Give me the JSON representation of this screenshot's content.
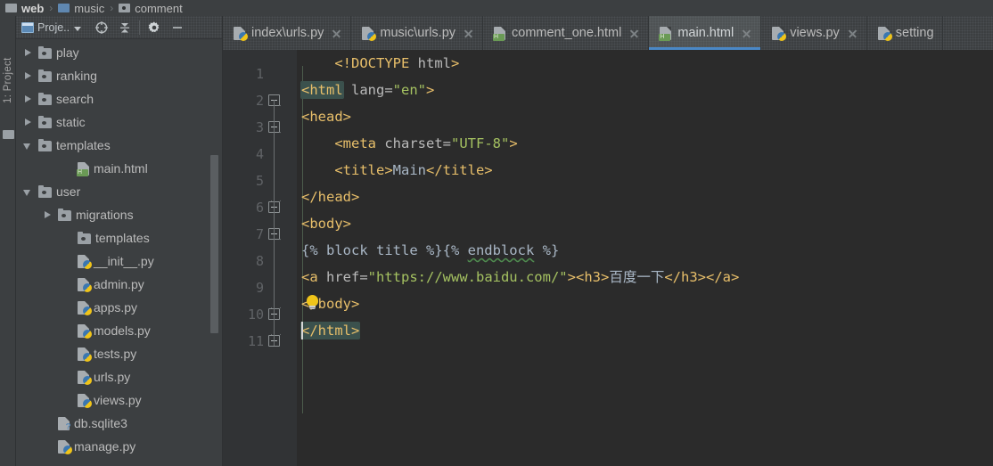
{
  "breadcrumb": {
    "items": [
      {
        "label": "web",
        "icon": "folder-icon"
      },
      {
        "label": "music",
        "icon": "folder-icon"
      },
      {
        "label": "comment",
        "icon": "folder-icon"
      }
    ],
    "separator": "›"
  },
  "toolwindow": {
    "vertical_tab_label": "1: Project"
  },
  "project_panel": {
    "title": "Proje..",
    "toolbar_buttons": [
      {
        "name": "select-opened-file-button",
        "icon": "target-icon"
      },
      {
        "name": "collapse-all-button",
        "icon": "collapse-all-icon"
      },
      {
        "name": "settings-button",
        "icon": "gear-icon"
      },
      {
        "name": "hide-button",
        "icon": "minimize-icon"
      }
    ],
    "tree": [
      {
        "label": "play",
        "icon": "folder-icon",
        "arrow": "right",
        "indent": 1
      },
      {
        "label": "ranking",
        "icon": "folder-icon",
        "arrow": "right",
        "indent": 1
      },
      {
        "label": "search",
        "icon": "folder-icon",
        "arrow": "right",
        "indent": 1
      },
      {
        "label": "static",
        "icon": "folder-icon",
        "arrow": "right",
        "indent": 1
      },
      {
        "label": "templates",
        "icon": "folder-icon",
        "arrow": "down",
        "indent": 1
      },
      {
        "label": "main.html",
        "icon": "html-file-icon",
        "arrow": "none",
        "indent": 3
      },
      {
        "label": "user",
        "icon": "folder-icon",
        "arrow": "down",
        "indent": 1
      },
      {
        "label": "migrations",
        "icon": "folder-icon",
        "arrow": "right",
        "indent": 2
      },
      {
        "label": "templates",
        "icon": "folder-icon",
        "arrow": "none",
        "indent": 3
      },
      {
        "label": "__init__.py",
        "icon": "python-file-icon",
        "arrow": "none",
        "indent": 3
      },
      {
        "label": "admin.py",
        "icon": "python-file-icon",
        "arrow": "none",
        "indent": 3
      },
      {
        "label": "apps.py",
        "icon": "python-file-icon",
        "arrow": "none",
        "indent": 3
      },
      {
        "label": "models.py",
        "icon": "python-file-icon",
        "arrow": "none",
        "indent": 3
      },
      {
        "label": "tests.py",
        "icon": "python-file-icon",
        "arrow": "none",
        "indent": 3
      },
      {
        "label": "urls.py",
        "icon": "python-file-icon",
        "arrow": "none",
        "indent": 3
      },
      {
        "label": "views.py",
        "icon": "python-file-icon",
        "arrow": "none",
        "indent": 3
      },
      {
        "label": "db.sqlite3",
        "icon": "sqlite-file-icon",
        "arrow": "none",
        "indent": 2
      },
      {
        "label": "manage.py",
        "icon": "python-file-icon",
        "arrow": "none",
        "indent": 2
      }
    ]
  },
  "editor_tabs": [
    {
      "label": "index\\urls.py",
      "icon": "python-file-icon",
      "active": false,
      "closable": true
    },
    {
      "label": "music\\urls.py",
      "icon": "python-file-icon",
      "active": false,
      "closable": true
    },
    {
      "label": "comment_one.html",
      "icon": "html-file-icon",
      "active": false,
      "closable": true
    },
    {
      "label": "main.html",
      "icon": "html-file-icon",
      "active": true,
      "closable": true
    },
    {
      "label": "views.py",
      "icon": "python-file-icon",
      "active": false,
      "closable": true
    },
    {
      "label": "setting",
      "icon": "python-file-icon",
      "active": false,
      "closable": false
    }
  ],
  "editor": {
    "active_file": "main.html",
    "line_numbers": [
      "1",
      "2",
      "3",
      "4",
      "5",
      "6",
      "7",
      "8",
      "9",
      "10",
      "11"
    ],
    "lines": [
      {
        "n": "1",
        "indent": "    ",
        "segments": [
          {
            "t": "<!DOCTYPE ",
            "c": "tag"
          },
          {
            "t": "html",
            "c": "attr"
          },
          {
            "t": ">",
            "c": "tag"
          }
        ]
      },
      {
        "n": "2",
        "indent": "",
        "segments": [
          {
            "t": "<html",
            "c": "tag",
            "hl": true
          },
          {
            "t": " lang=",
            "c": "attr"
          },
          {
            "t": "\"en\"",
            "c": "str"
          },
          {
            "t": ">",
            "c": "tag"
          }
        ]
      },
      {
        "n": "3",
        "indent": "",
        "segments": [
          {
            "t": "<head>",
            "c": "tag"
          }
        ]
      },
      {
        "n": "4",
        "indent": "    ",
        "segments": [
          {
            "t": "<meta",
            "c": "tag"
          },
          {
            "t": " charset=",
            "c": "attr"
          },
          {
            "t": "\"UTF-8\"",
            "c": "str"
          },
          {
            "t": ">",
            "c": "tag"
          }
        ]
      },
      {
        "n": "5",
        "indent": "    ",
        "segments": [
          {
            "t": "<title>",
            "c": "tag"
          },
          {
            "t": "Main",
            "c": "text"
          },
          {
            "t": "</title>",
            "c": "tag"
          }
        ]
      },
      {
        "n": "6",
        "indent": "",
        "segments": [
          {
            "t": "</head>",
            "c": "tag"
          }
        ]
      },
      {
        "n": "7",
        "indent": "",
        "segments": [
          {
            "t": "<body>",
            "c": "tag"
          }
        ]
      },
      {
        "n": "8",
        "indent": "",
        "segments": [
          {
            "t": "{% block title %}{% ",
            "c": "text"
          },
          {
            "t": "endblock",
            "c": "text",
            "squiggle": true
          },
          {
            "t": " %}",
            "c": "text"
          }
        ]
      },
      {
        "n": "9",
        "indent": "",
        "segments": [
          {
            "t": "<a",
            "c": "tag"
          },
          {
            "t": " href=",
            "c": "attr"
          },
          {
            "t": "\"https://www.baidu.com/\"",
            "c": "str"
          },
          {
            "t": ">",
            "c": "tag"
          },
          {
            "t": "<h3>",
            "c": "tag"
          },
          {
            "t": "百度一下",
            "c": "cn"
          },
          {
            "t": "</h3>",
            "c": "tag"
          },
          {
            "t": "</a>",
            "c": "tag"
          }
        ]
      },
      {
        "n": "10",
        "indent": "",
        "segments": [
          {
            "t": "</body>",
            "c": "tag"
          }
        ]
      },
      {
        "n": "11",
        "indent": "",
        "segments": [
          {
            "t": "</html>",
            "c": "tag",
            "hl": true
          }
        ]
      }
    ],
    "intention_bulb_line": 10,
    "caret_line": 11,
    "fold_markers": [
      2,
      3,
      6,
      7,
      10,
      11
    ]
  },
  "colors": {
    "accent": "#4a88c7",
    "editor_bg": "#2b2b2b",
    "gutter_bg": "#313335",
    "panel_bg": "#3c3f41",
    "tag": "#e8bf6a",
    "string": "#a5c261",
    "text": "#a9b7c6",
    "match_highlight": "#3b514d"
  }
}
